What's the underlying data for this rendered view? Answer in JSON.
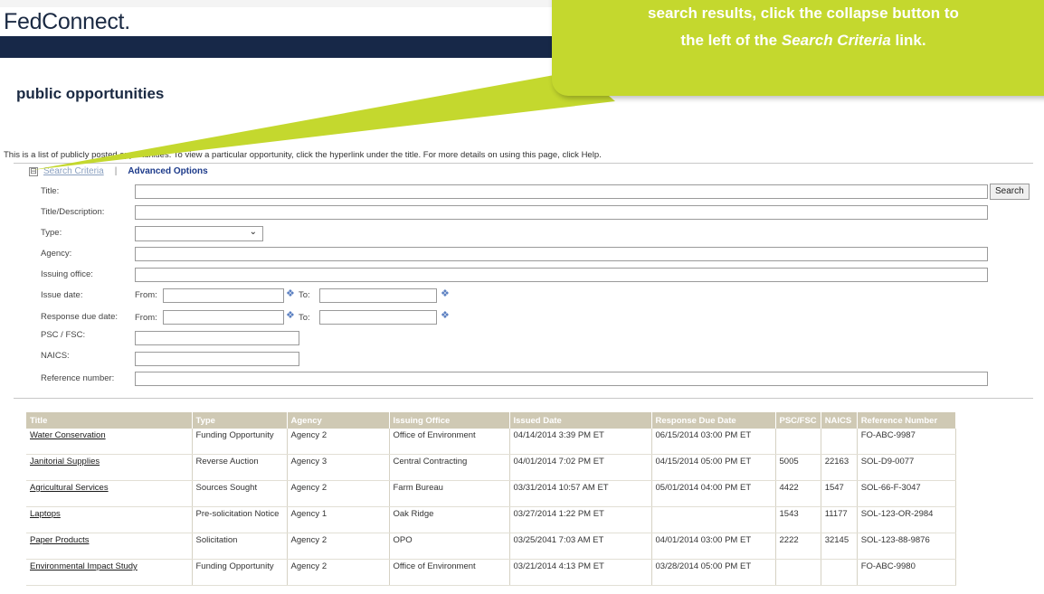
{
  "brand": "FedConnect.",
  "page_title": "public opportunities",
  "intro": "This is a list of publicly posted opportunities. To view a particular opportunity, click the hyperlink under the title. For more details on using this page, click Help.",
  "criteria": {
    "collapse": "⊟",
    "search_criteria": "Search Criteria",
    "separator": "|",
    "advanced_options": "Advanced Options"
  },
  "form": {
    "title": "Title:",
    "title_description": "Title/Description:",
    "type": "Type:",
    "agency": "Agency:",
    "issuing_office": "Issuing office:",
    "issue_date": "Issue date:",
    "response_due_date": "Response due date:",
    "psc_fsc": "PSC / FSC:",
    "naics": "NAICS:",
    "reference_number": "Reference number:",
    "from": "From:",
    "to": "To:",
    "search_button": "Search"
  },
  "table": {
    "headers": [
      "Title",
      "Type",
      "Agency",
      "Issuing Office",
      "Issued Date",
      "Response Due Date",
      "PSC/FSC",
      "NAICS",
      "Reference Number"
    ],
    "rows": [
      [
        "Water Conservation",
        "Funding Opportunity",
        "Agency 2",
        "Office of Environment",
        "04/14/2014 3:39 PM ET",
        "06/15/2014 03:00 PM ET",
        "",
        "",
        "FO-ABC-9987"
      ],
      [
        "Janitorial Supplies",
        "Reverse Auction",
        "Agency 3",
        "Central Contracting",
        "04/01/2014 7:02 PM ET",
        "04/15/2014 05:00 PM ET",
        "5005",
        "22163",
        "SOL-D9-0077"
      ],
      [
        "Agricultural Services",
        "Sources Sought",
        "Agency 2",
        "Farm Bureau",
        "03/31/2014 10:57 AM ET",
        "05/01/2014 04:00 PM ET",
        "4422",
        "1547",
        "SOL-66-F-3047"
      ],
      [
        "Laptops",
        "Pre-solicitation Notice",
        "Agency 1",
        "Oak Ridge",
        "03/27/2014 1:22 PM ET",
        "",
        "1543",
        "11177",
        "SOL-123-OR-2984"
      ],
      [
        "Paper Products",
        "Solicitation",
        "Agency 2",
        "OPO",
        "03/25/2041 7:03 AM ET",
        "04/01/2014 03:00 PM ET",
        "2222",
        "32145",
        "SOL-123-88-9876"
      ],
      [
        "Environmental Impact Study",
        "Funding Opportunity",
        "Agency 2",
        "Office of Environment",
        "03/21/2014 4:13 PM ET",
        "03/28/2014 05:00 PM ET",
        "",
        "",
        "FO-ABC-9980"
      ]
    ]
  },
  "callout": {
    "line1": "search results, click the collapse button to",
    "line2_prefix": "the left of the ",
    "line2_em": "Search Criteria",
    "line2_suffix": " link."
  },
  "colors": {
    "header_bar": "#172848",
    "callout": "#c4d82e",
    "table_header": "#cfc9b4"
  }
}
